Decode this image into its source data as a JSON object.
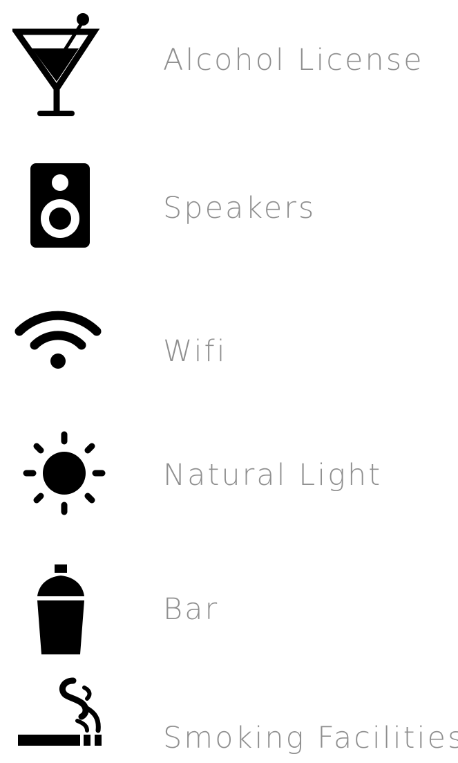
{
  "amenities": [
    {
      "icon": "cocktail-icon",
      "label": "Alcohol License"
    },
    {
      "icon": "speaker-icon",
      "label": "Speakers"
    },
    {
      "icon": "wifi-icon",
      "label": "Wifi"
    },
    {
      "icon": "sun-icon",
      "label": "Natural Light"
    },
    {
      "icon": "shaker-icon",
      "label": "Bar"
    },
    {
      "icon": "smoking-icon",
      "label": "Smoking Facilities"
    }
  ],
  "colors": {
    "icon": "#000000",
    "label": "#8f8f8f",
    "background": "#ffffff"
  }
}
